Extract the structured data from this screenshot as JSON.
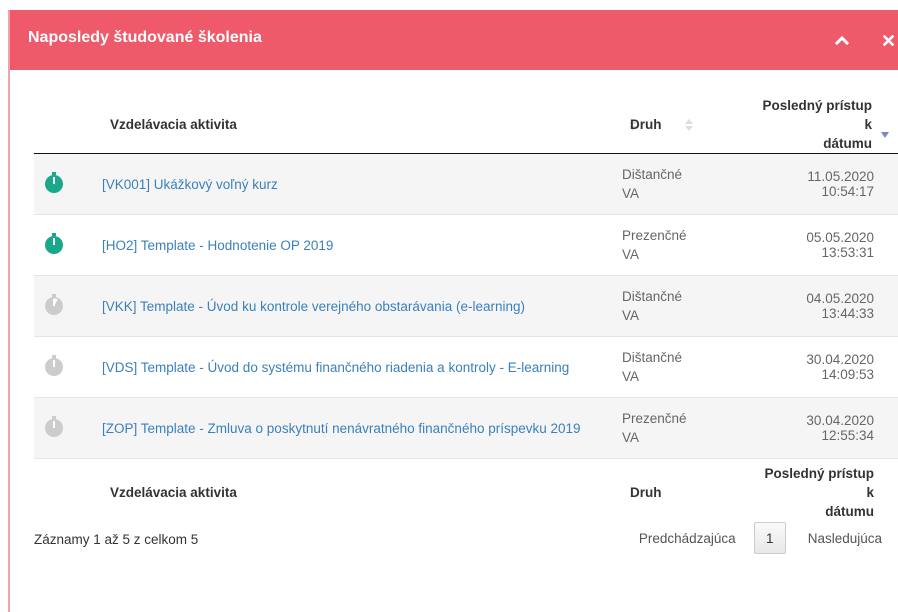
{
  "panel": {
    "title": "Naposledy študované školenia",
    "colors": {
      "header": "#ef5a6b",
      "link": "#3a80bd",
      "done": "#1aa88a",
      "pending": "#cccccc"
    }
  },
  "table": {
    "headers": {
      "activity": "Vzdelávacia aktivita",
      "type": "Druh",
      "last_access_line1": "Posledný prístup k",
      "last_access_line2": "dátumu"
    },
    "rows": [
      {
        "status": "done",
        "activity": "[VK001] Ukážkový voľný kurz",
        "type_line1": "Dištančné",
        "type_line2": "VA",
        "date": "11.05.2020 10:54:17"
      },
      {
        "status": "done",
        "activity": "[HO2] Template - Hodnotenie OP 2019",
        "type_line1": "Prezenčné",
        "type_line2": "VA",
        "date": "05.05.2020 13:53:31"
      },
      {
        "status": "started",
        "activity": "[VKK] Template - Úvod ku kontrole verejného obstarávania (e-learning)",
        "type_line1": "Dištančné",
        "type_line2": "VA",
        "date": "04.05.2020 13:44:33"
      },
      {
        "status": "not-started",
        "activity": "[VDS] Template - Úvod do systému finančného riadenia a kontroly - E-learning",
        "type_line1": "Dištančné",
        "type_line2": "VA",
        "date": "30.04.2020 14:09:53"
      },
      {
        "status": "not-started",
        "activity": "[ZOP] Template - Zmluva o poskytnutí nenávratného finančného príspevku 2019",
        "type_line1": "Prezenčné",
        "type_line2": "VA",
        "date": "30.04.2020 12:55:34"
      }
    ]
  },
  "footer": {
    "info": "Záznamy 1 až 5 z celkom 5",
    "prev": "Predchádzajúca",
    "page": "1",
    "next": "Nasledujúca"
  }
}
